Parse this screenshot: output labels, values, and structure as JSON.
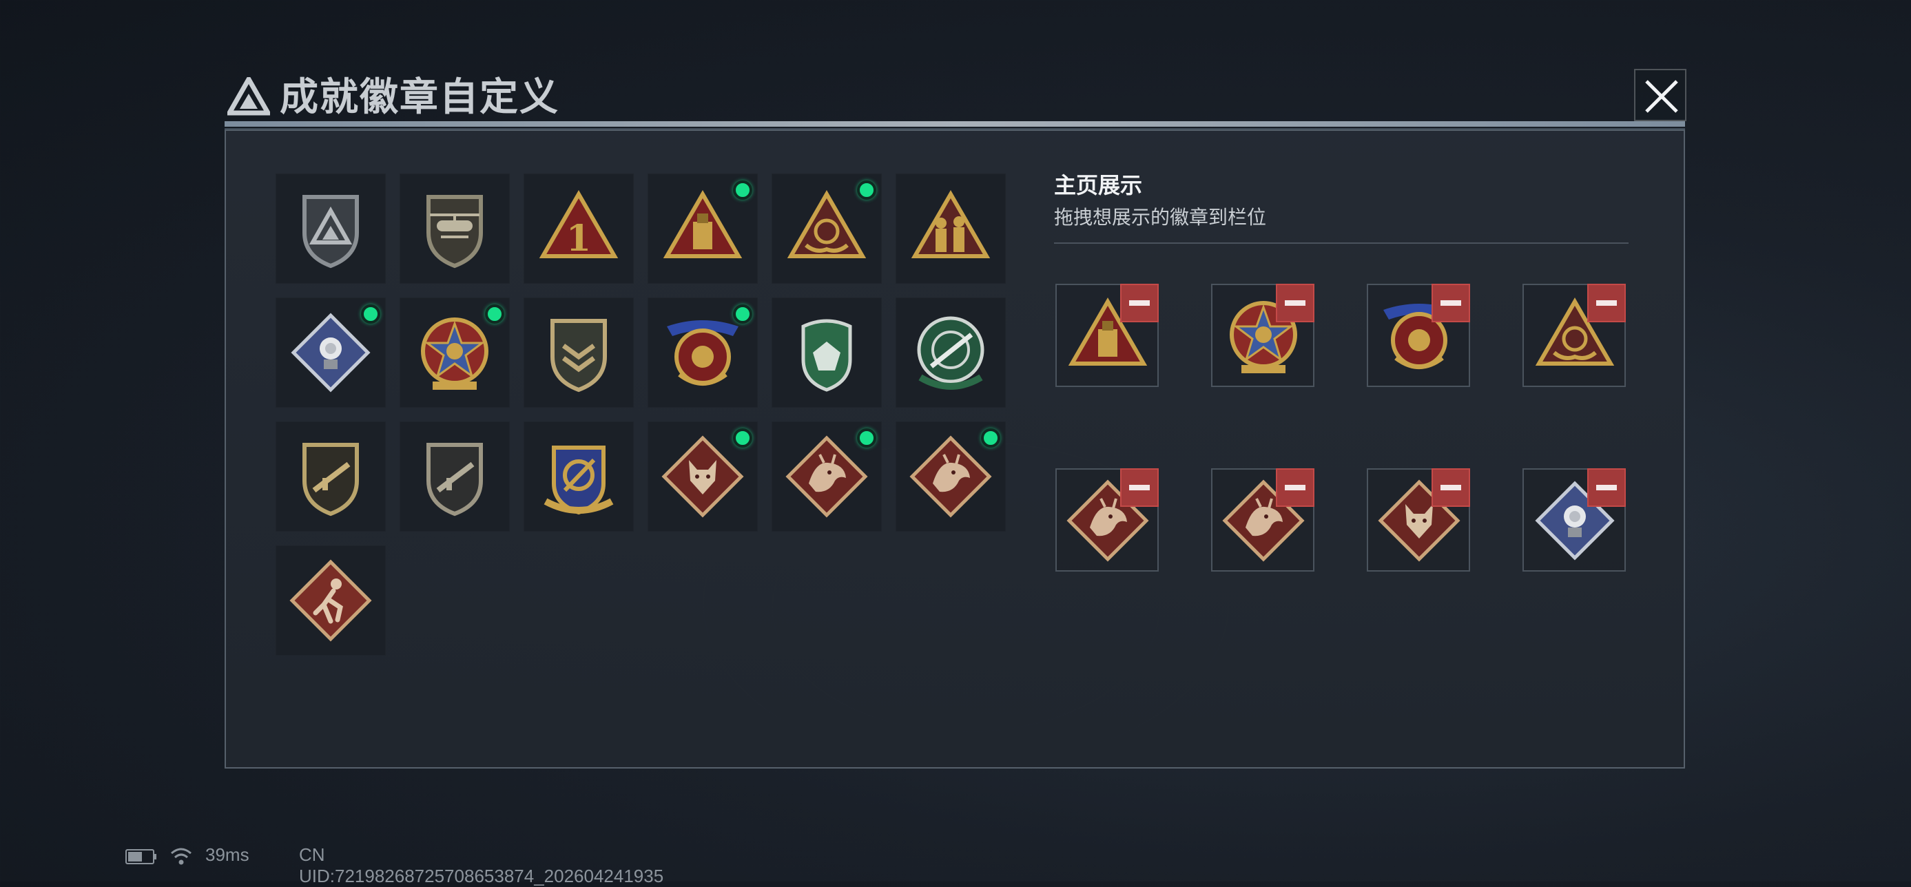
{
  "window": {
    "title": "成就徽章自定义",
    "close_icon": "close-icon"
  },
  "colors": {
    "new_indicator": "#17e08a",
    "remove_button": "#a23a3a",
    "panel_border": "#56606b"
  },
  "badge_grid": {
    "rows": [
      [
        {
          "icon": "gray-triangle-shield",
          "is_new": false
        },
        {
          "icon": "helicopter-shield",
          "is_new": false
        },
        {
          "icon": "number-one-triangle",
          "is_new": false
        },
        {
          "icon": "usb-drive-triangle",
          "is_new": true
        },
        {
          "icon": "heart-hands-triangle",
          "is_new": true
        },
        {
          "icon": "soldiers-triangle",
          "is_new": false
        }
      ],
      [
        {
          "icon": "rose-diamond",
          "is_new": true
        },
        {
          "icon": "star-medal",
          "is_new": true
        },
        {
          "icon": "chevron-shield",
          "is_new": false
        },
        {
          "icon": "ribbon-crest",
          "is_new": true
        },
        {
          "icon": "green-gem-shield",
          "is_new": false
        },
        {
          "icon": "green-rifle-crosshair",
          "is_new": false
        }
      ],
      [
        {
          "icon": "rifle-shield-gold",
          "is_new": false
        },
        {
          "icon": "rifle-shield-gray",
          "is_new": false
        },
        {
          "icon": "blue-wrench-crest",
          "is_new": false
        },
        {
          "icon": "wolf-diamond",
          "is_new": true
        },
        {
          "icon": "dragon-diamond",
          "is_new": true
        },
        {
          "icon": "dragon-diamond",
          "is_new": true
        }
      ],
      [
        {
          "icon": "runner-diamond",
          "is_new": false
        }
      ]
    ]
  },
  "homepage_display": {
    "title": "主页展示",
    "hint": "拖拽想展示的徽章到栏位",
    "slots": [
      {
        "icon": "usb-drive-triangle"
      },
      {
        "icon": "star-medal"
      },
      {
        "icon": "ribbon-crest"
      },
      {
        "icon": "heart-hands-triangle"
      },
      {
        "icon": "dragon-diamond"
      },
      {
        "icon": "dragon-diamond"
      },
      {
        "icon": "wolf-diamond"
      },
      {
        "icon": "rose-diamond"
      }
    ],
    "remove_icon": "minus-icon"
  },
  "status_bar": {
    "battery_icon": "battery-icon",
    "wifi_icon": "wifi-icon",
    "ping": "39ms",
    "uid": "CN UID:72198268725708653874_202604241935"
  }
}
